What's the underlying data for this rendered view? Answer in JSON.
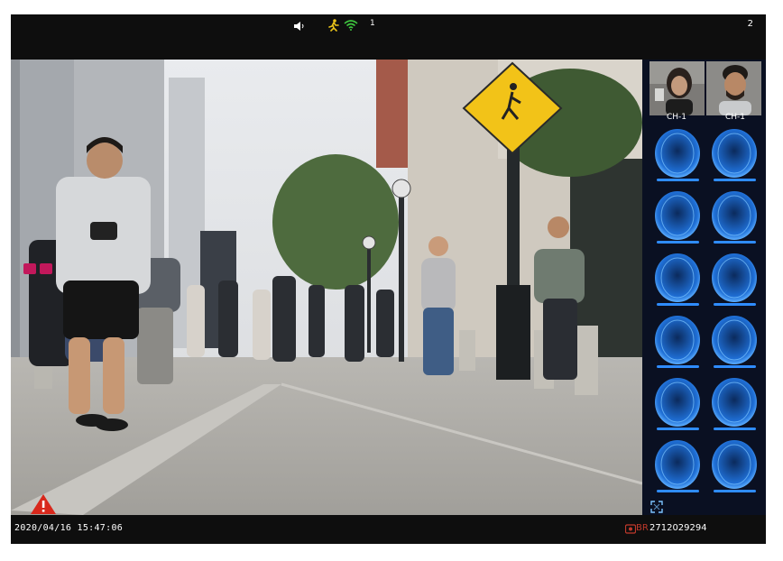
{
  "status_bar": {
    "icons": [
      "speaker-icon",
      "motion-person-icon",
      "wifi-icon"
    ],
    "channel_count": "1",
    "page_number": "2"
  },
  "main_view": {
    "content": "street-camera-feed"
  },
  "side_panel": {
    "thumbnails": [
      {
        "label": "CH-1"
      },
      {
        "label": "CH-1"
      }
    ],
    "grid_cells": 12,
    "icons": [
      "face-scan-icon",
      "expand-icon"
    ]
  },
  "bottom_bar": {
    "datetime": "2020/04/16 15:47:06",
    "serial_prefix": "BR",
    "serial": "2712029294",
    "icons": [
      "record-icon"
    ]
  },
  "overlay": {
    "icons": [
      "alarm-warning-icon"
    ]
  },
  "colors": {
    "bar_bg": "#0e0e0e",
    "panel_bg": "#0a1022",
    "face_glow": "#2f8cff",
    "alarm_red": "#d8281c",
    "motion_yellow": "#e8c21a",
    "wifi_green": "#3ec43e"
  }
}
